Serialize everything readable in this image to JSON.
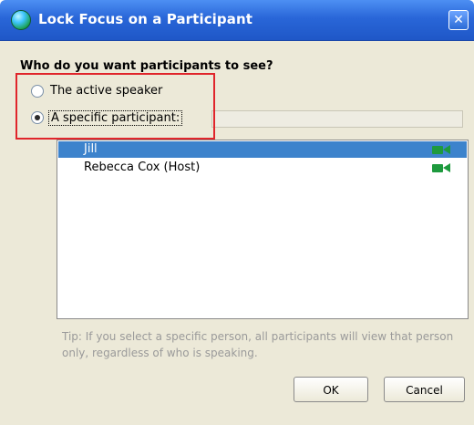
{
  "window": {
    "title": "Lock Focus on a Participant",
    "close_glyph": "✕"
  },
  "dialog": {
    "question": "Who do you want participants to see?",
    "options": [
      {
        "label": "The active speaker",
        "selected": false
      },
      {
        "label": "A specific participant:",
        "selected": true
      }
    ],
    "participants": [
      {
        "name": "Jill",
        "selected": true,
        "icon": "video-camera-icon"
      },
      {
        "name": "Rebecca Cox (Host)",
        "selected": false,
        "icon": "video-camera-icon"
      }
    ],
    "tip": "Tip: If you select a specific person, all participants will view that person only, regardless of who is speaking.",
    "buttons": {
      "ok": "OK",
      "cancel": "Cancel"
    }
  },
  "colors": {
    "titlebar": "#2966d8",
    "selection": "#3d83cc",
    "highlight_box": "#e0252b",
    "camera": "#1e9a3e"
  }
}
